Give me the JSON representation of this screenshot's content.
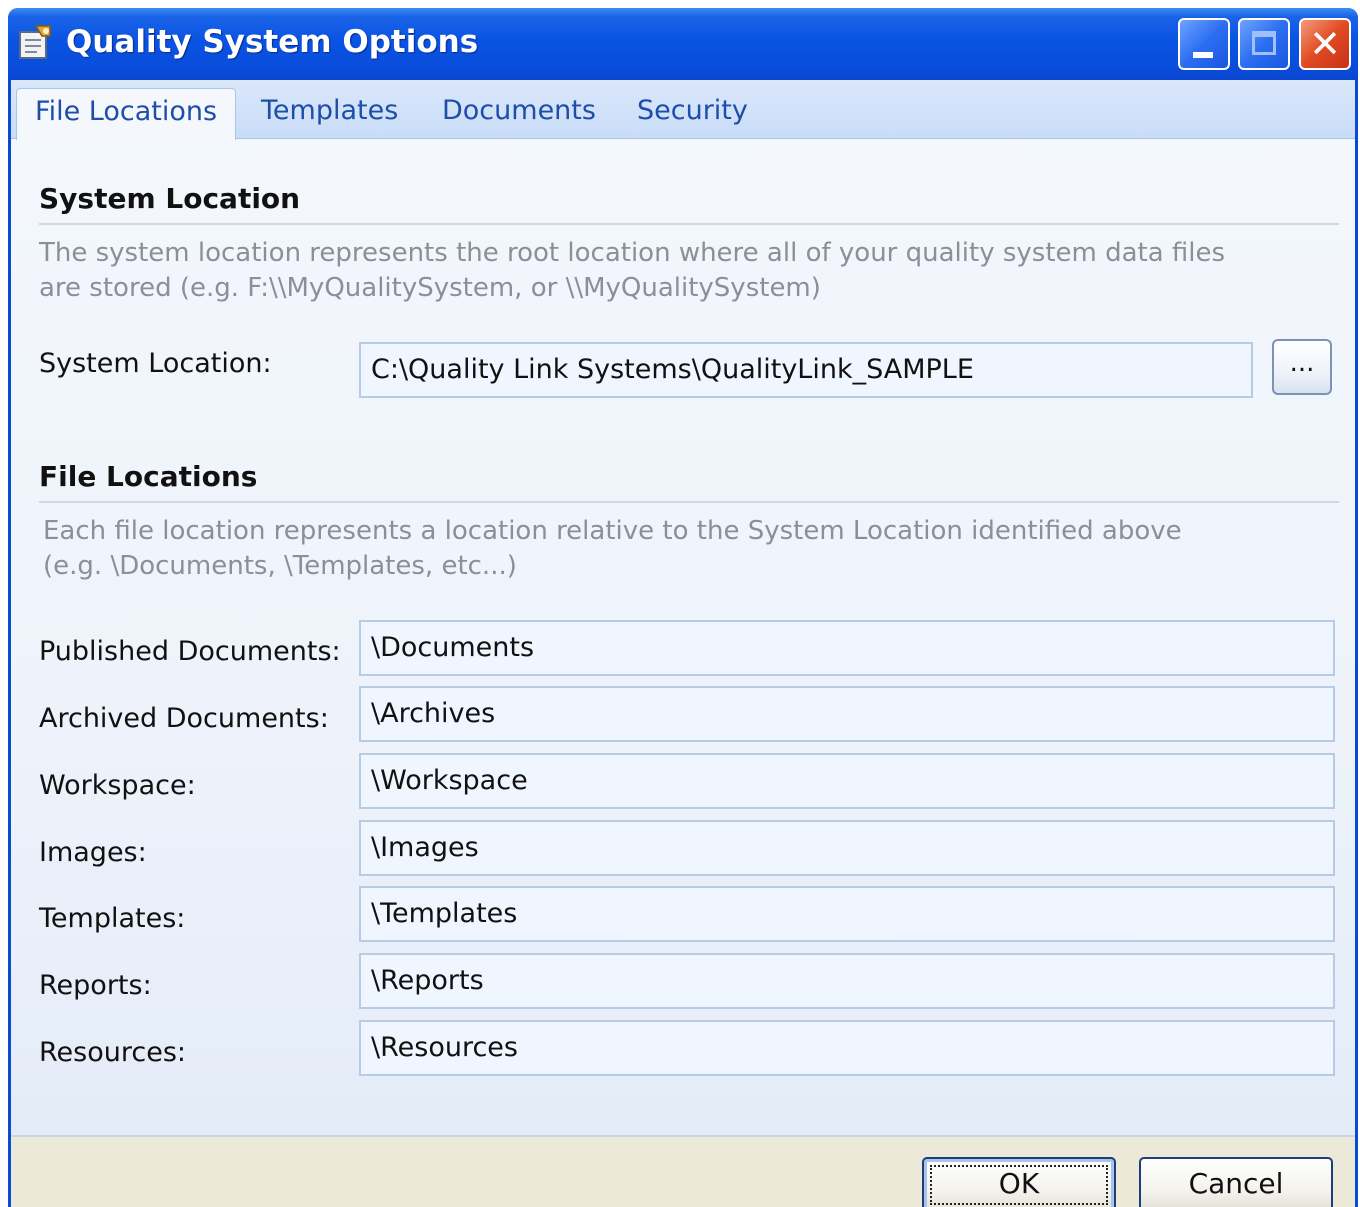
{
  "window": {
    "title": "Quality System Options"
  },
  "tabs": [
    {
      "label": "File Locations",
      "active": true
    },
    {
      "label": "Templates",
      "active": false
    },
    {
      "label": "Documents",
      "active": false
    },
    {
      "label": "Security",
      "active": false
    }
  ],
  "system_location": {
    "heading": "System Location",
    "description": "The system location represents the root location where all of your quality system data files are stored (e.g. F:\\\\MyQualitySystem, or \\\\MyQualitySystem)",
    "label": "System Location:",
    "value": "C:\\Quality Link Systems\\QualityLink_SAMPLE",
    "browse_label": "..."
  },
  "file_locations": {
    "heading": "File Locations",
    "description": "Each file location represents a location relative to the System Location identified above (e.g. \\Documents, \\Templates, etc...)",
    "fields": [
      {
        "label": "Published Documents:",
        "value": "\\Documents"
      },
      {
        "label": "Archived Documents:",
        "value": "\\Archives"
      },
      {
        "label": "Workspace:",
        "value": "\\Workspace"
      },
      {
        "label": "Images:",
        "value": "\\Images"
      },
      {
        "label": "Templates:",
        "value": "\\Templates"
      },
      {
        "label": "Reports:",
        "value": "\\Reports"
      },
      {
        "label": "Resources:",
        "value": "\\Resources"
      }
    ]
  },
  "buttons": {
    "ok": "OK",
    "cancel": "Cancel"
  },
  "icons": {
    "app": "options-document-icon",
    "minimize": "minimize-icon",
    "maximize": "maximize-icon",
    "close": "close-icon"
  },
  "colors": {
    "titlebar": "#0a54e3",
    "tab_text": "#1d4fa8",
    "description_text": "#8a8f98",
    "close_button": "#e14a22"
  }
}
